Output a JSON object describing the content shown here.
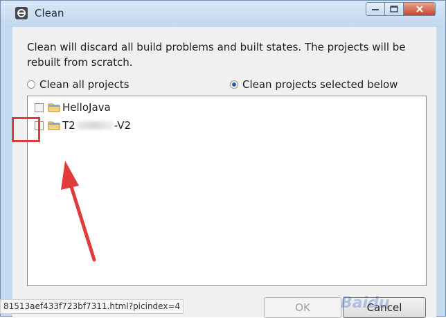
{
  "window": {
    "title": "Clean",
    "icon": "eclipse-icon",
    "controls": [
      "minimize",
      "maximize",
      "close"
    ]
  },
  "description": "Clean will discard all build problems and built states.  The projects will be rebuilt from scratch.",
  "options": {
    "clean_all_label": "Clean all projects",
    "clean_selected_label": "Clean projects selected below",
    "selected": "clean_selected"
  },
  "projects": [
    {
      "name": "HelloJava",
      "checked": false
    },
    {
      "name_prefix": "T2",
      "name_suffix": "-V2",
      "checked": false
    }
  ],
  "buttons": {
    "ok_label": "OK",
    "ok_enabled": false,
    "cancel_label": "Cancel"
  },
  "overlay": {
    "url_text": "81513aef433f723bf7311.html?picindex=4",
    "watermark": "Baidu",
    "annotation_color": "#e03c3c"
  }
}
